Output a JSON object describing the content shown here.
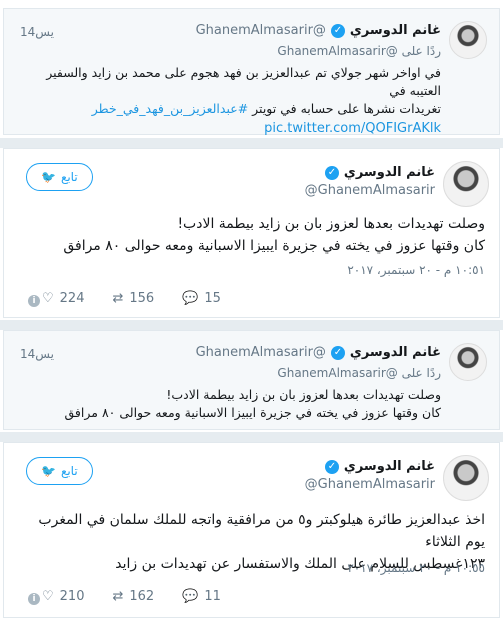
{
  "top_reply": {
    "name": "غانم الدوسري",
    "handle": "@GhanemAlmasarir",
    "time": "14يس",
    "reply_prefix": "ردًا على",
    "reply_handle": "@GhanemAlmasarir",
    "line1": "في اواخر شهر جولاي تم عبدالعزيز بن فهد هجوم على محمد بن زايد والسفير العتيبه في",
    "line2": "تغريدات نشرها على حسابه في تويتر",
    "hashtag": "#عبدالعزيز_بن_فهد_في_خطر",
    "pic": "pic.twitter.com/QOFIGrAKlk"
  },
  "tweet1": {
    "name": "غانم الدوسري",
    "handle": "@GhanemAlmasarir",
    "follow_label": "تابع",
    "line1": "وصلت تهديدات بعدها لعزوز بان بن زايد بيطمة الادب!",
    "line2": "كان وقتها عزوز في يخته في جزيرة ايبيزا الاسبانية ومعه حوالى ٨٠ مرافق",
    "date": "١٠:٥١ م - ٢٠ سبتمبر، ٢٠١٧",
    "likes": "224",
    "retweets": "156",
    "replies": "15"
  },
  "mid_reply": {
    "name": "غانم الدوسري",
    "handle": "@GhanemAlmasarir",
    "time": "14يس",
    "reply_prefix": "ردًا على",
    "reply_handle": "@GhanemAlmasarir",
    "line1": "وصلت تهديدات بعدها لعزوز بان بن زايد بيطمة الادب!",
    "line2": "كان وقتها عزوز في يخته في جزيرة ايبيزا الاسبانية ومعه حوالى ٨٠ مرافق"
  },
  "tweet2": {
    "name": "غانم الدوسري",
    "handle": "@GhanemAlmasarir",
    "follow_label": "تابع",
    "line1": "اخذ عبدالعزيز طائرة هيلوكبتر و٥ من مرافقية واتجه للملك سلمان في المغرب يوم الثلاثاء",
    "line2": "١٢٣غسطس للسلام على الملك والاستفسار عن تهديدات بن زايد",
    "date": "١٠:٥٥ م - ٢٠ سبتمبر، ٢٠١٧",
    "likes": "210",
    "retweets": "162",
    "replies": "11"
  }
}
